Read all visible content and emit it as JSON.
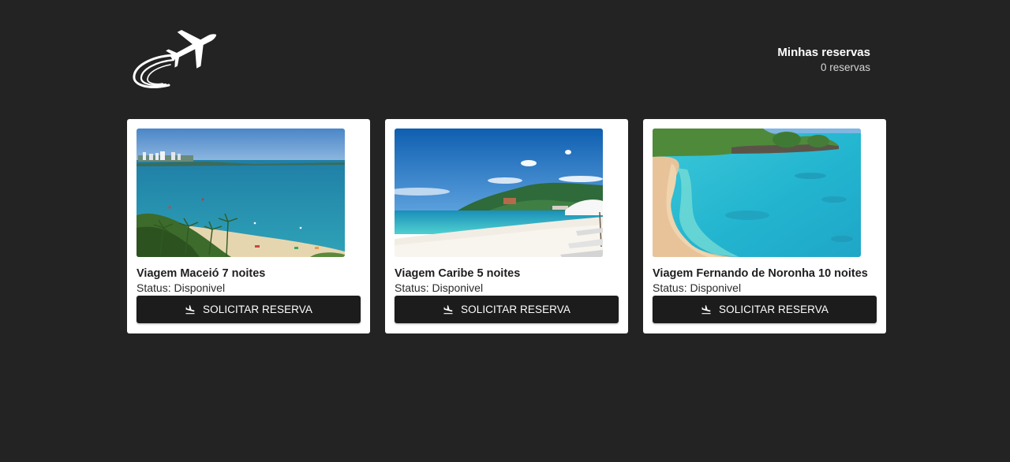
{
  "header": {
    "logo_icon": "airplane-logo-icon",
    "reservations_title": "Minhas reservas",
    "reservations_count": "0 reservas"
  },
  "trips": [
    {
      "name": "Viagem Maceió 7 noites",
      "status": "Status: Disponivel",
      "button_label": "SOLICITAR RESERVA",
      "button_icon": "flight-land-icon",
      "image": "beach-photo-maceio"
    },
    {
      "name": "Viagem Caribe 5 noites",
      "status": "Status: Disponivel",
      "button_label": "SOLICITAR RESERVA",
      "button_icon": "flight-land-icon",
      "image": "beach-photo-caribe"
    },
    {
      "name": "Viagem Fernando de Noronha 10 noites",
      "status": "Status: Disponivel",
      "button_label": "SOLICITAR RESERVA",
      "button_icon": "flight-land-icon",
      "image": "beach-photo-noronha"
    }
  ],
  "colors": {
    "background": "#232323",
    "card": "#ffffff",
    "button": "#1c1c1c"
  }
}
